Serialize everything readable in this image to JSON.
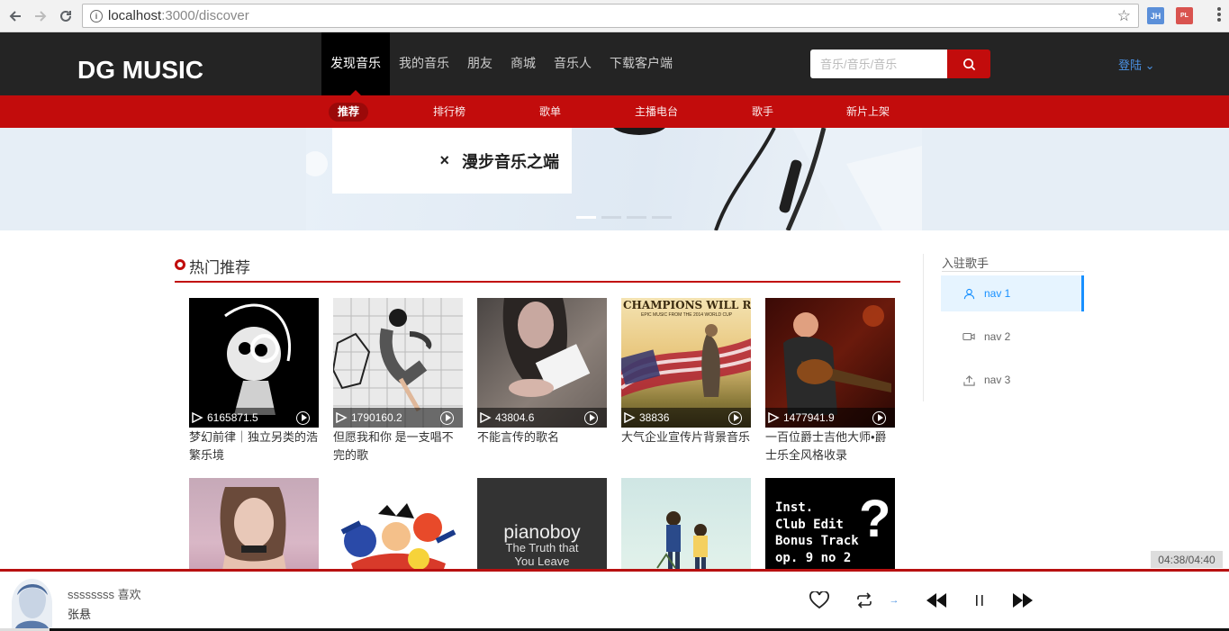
{
  "browser": {
    "url_host": "localhost",
    "url_path": ":3000/discover",
    "ext1": "JH",
    "ext2": "PL"
  },
  "header": {
    "logo": "DG MUSIC",
    "nav": [
      "发现音乐",
      "我的音乐",
      "朋友",
      "商城",
      "音乐人",
      "下载客户端"
    ],
    "active_nav": 0,
    "search_placeholder": "音乐/音乐/音乐",
    "login": "登陆 ⌄"
  },
  "subnav": {
    "items": [
      "推荐",
      "排行榜",
      "歌单",
      "主播电台",
      "歌手",
      "新片上架"
    ],
    "active": 0
  },
  "banner": {
    "text": "漫步音乐之端",
    "close": "×"
  },
  "section": {
    "title": "热门推荐"
  },
  "playlists": [
    {
      "count": "6165871.5",
      "name": "梦幻前律｜独立另类的浩繁乐境"
    },
    {
      "count": "1790160.2",
      "name": "但愿我和你 是一支唱不完的歌"
    },
    {
      "count": "43804.6",
      "name": "不能言传的歌名"
    },
    {
      "count": "38836",
      "name": "大气企业宣传片背景音乐"
    },
    {
      "count": "1477941.9",
      "name": "一百位爵士吉他大师•爵士乐全风格收录"
    },
    {
      "count": "",
      "name": ""
    },
    {
      "count": "",
      "name": ""
    },
    {
      "count": "",
      "name": ""
    },
    {
      "count": "",
      "name": ""
    },
    {
      "count": "",
      "name": ""
    }
  ],
  "cover_texts": {
    "champions": "CHAMPIONS WILL RISE",
    "champions_sub": "EPIC MUSIC FROM THE 2014 WORLD CUP",
    "piano_title": "pianoboy",
    "piano_sub1": "The Truth that",
    "piano_sub2": "You Leave",
    "inst_lines": [
      "Inst.",
      "Club Edit",
      "Bonus Track",
      "op. 9 no 2"
    ],
    "inst_q": "?"
  },
  "side": {
    "title": "入驻歌手",
    "items": [
      "nav 1",
      "nav 2",
      "nav 3"
    ],
    "active": 0
  },
  "player": {
    "song": "ssssssss 喜欢",
    "artist": "张悬",
    "time": "04:38/04:40",
    "progress_fraction": 0.996
  },
  "colors": {
    "brand_red": "#c20c0c",
    "header_bg": "#242424",
    "accent_blue": "#1890ff"
  }
}
